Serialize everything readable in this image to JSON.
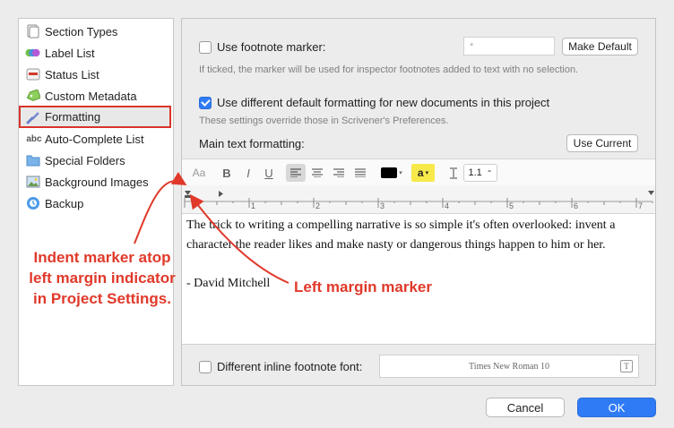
{
  "sidebar": {
    "items": [
      {
        "label": "Section Types",
        "icon": "section-types-icon"
      },
      {
        "label": "Label List",
        "icon": "label-list-icon"
      },
      {
        "label": "Status List",
        "icon": "status-list-icon"
      },
      {
        "label": "Custom Metadata",
        "icon": "tag-icon"
      },
      {
        "label": "Formatting",
        "icon": "brush-icon",
        "selected": true
      },
      {
        "label": "Auto-Complete List",
        "icon": "abc-icon"
      },
      {
        "label": "Special Folders",
        "icon": "folder-icon"
      },
      {
        "label": "Background Images",
        "icon": "image-icon"
      },
      {
        "label": "Backup",
        "icon": "backup-icon"
      }
    ]
  },
  "footnote_marker": {
    "label": "Use footnote marker:",
    "checked": false,
    "value": "*",
    "make_default": "Make Default",
    "hint": "If ticked, the marker will be used for inspector footnotes added to text with no selection."
  },
  "default_formatting": {
    "label": "Use different default formatting for new documents in this project",
    "checked": true,
    "hint": "These settings override those in Scrivener's Preferences."
  },
  "main_text": {
    "label": "Main text formatting:",
    "use_current": "Use Current"
  },
  "toolbar": {
    "font_glyph": "Aa",
    "bold": "B",
    "italic": "I",
    "underline": "U",
    "highlight_glyph": "a",
    "spacing_value": "1.1"
  },
  "ruler": {
    "numbers": [
      "1",
      "2",
      "3",
      "4",
      "5",
      "6",
      "7"
    ]
  },
  "editor": {
    "paragraph1": "The trick to writing a compelling narrative is so simple it's often overlooked: invent a character the reader likes and make nasty or dangerous things happen to him or her.",
    "paragraph2": "- David Mitchell"
  },
  "inline_footnote": {
    "label": "Different inline footnote font:",
    "checked": false,
    "font_value": "Times New Roman 10"
  },
  "annotations": {
    "indent_marker": "Indent marker atop left margin indicator in Project Settings.",
    "left_margin": "Left margin marker"
  },
  "dialog_buttons": {
    "cancel": "Cancel",
    "ok": "OK"
  },
  "colors": {
    "accent": "#2f7bf6",
    "annotation": "#e0392a",
    "highlight": "#f7e94a"
  }
}
